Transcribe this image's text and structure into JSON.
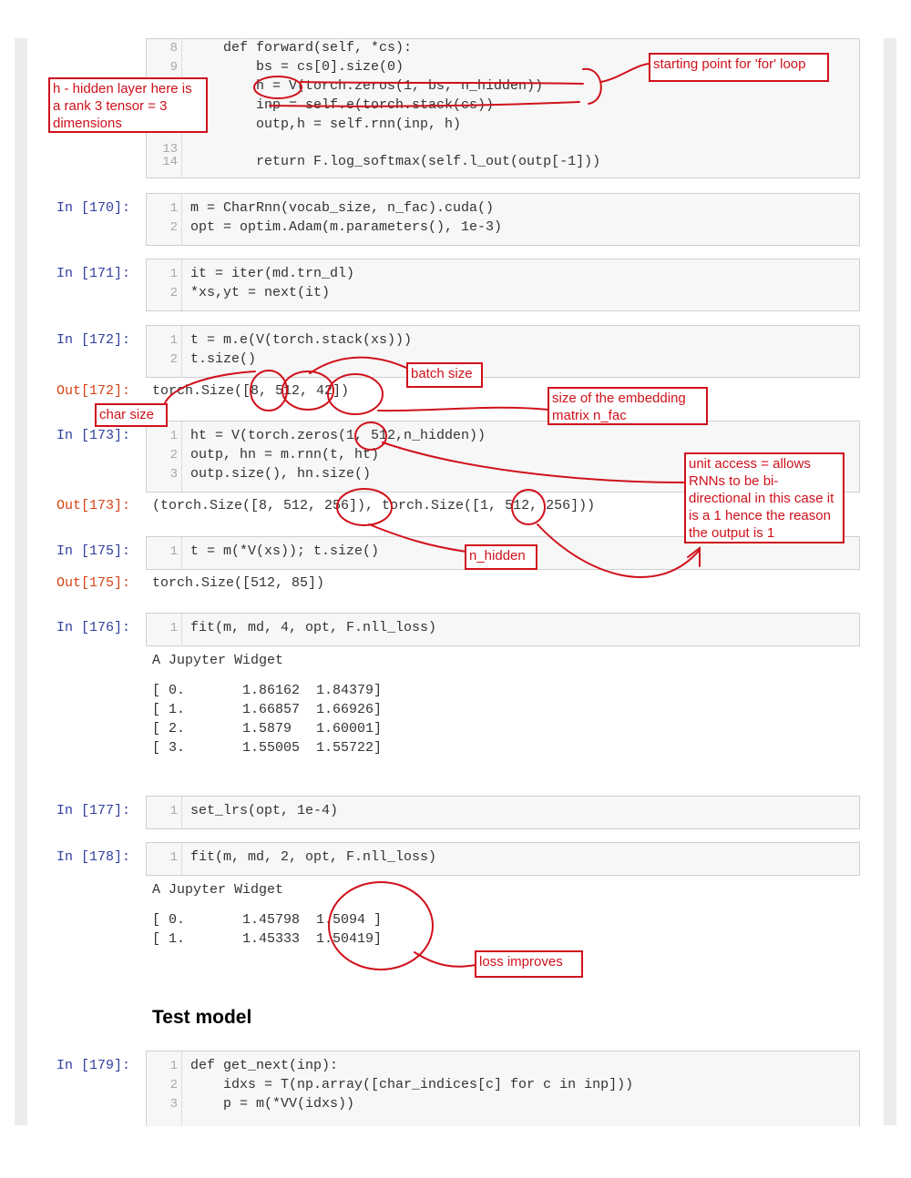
{
  "cells": [
    {
      "kind": "code-continued",
      "prompt": "",
      "lines": [
        {
          "n": "8",
          "text": "    def forward(self, *cs):"
        },
        {
          "n": "9",
          "text": "        bs = cs[0].size(0)"
        },
        {
          "n": "10",
          "text": "        h = V(torch.zeros(1, bs, n_hidden))"
        },
        {
          "n": "11",
          "text": "        inp = self.e(torch.stack(cs))"
        },
        {
          "n": "12",
          "text": "        outp,h = self.rnn(inp, h)"
        },
        {
          "n": "13",
          "text": ""
        },
        {
          "n": "14",
          "text": "        return F.log_softmax(self.l_out(outp[-1]))"
        }
      ]
    },
    {
      "prompt": "In [170]:",
      "lines": [
        {
          "n": "1",
          "text": "m = CharRnn(vocab_size, n_fac).cuda()"
        },
        {
          "n": "2",
          "text": "opt = optim.Adam(m.parameters(), 1e-3)"
        }
      ]
    },
    {
      "prompt": "In [171]:",
      "lines": [
        {
          "n": "1",
          "text": "it = iter(md.trn_dl)"
        },
        {
          "n": "2",
          "text": "*xs,yt = next(it)"
        }
      ]
    },
    {
      "prompt": "In [172]:",
      "lines": [
        {
          "n": "1",
          "text": "t = m.e(V(torch.stack(xs)))"
        },
        {
          "n": "2",
          "text": "t.size()"
        }
      ]
    },
    {
      "prompt": "In [173]:",
      "lines": [
        {
          "n": "1",
          "text": "ht = V(torch.zeros(1, 512,n_hidden))"
        },
        {
          "n": "2",
          "text": "outp, hn = m.rnn(t, ht)"
        },
        {
          "n": "3",
          "text": "outp.size(), hn.size()"
        }
      ]
    },
    {
      "prompt": "In [175]:",
      "lines": [
        {
          "n": "1",
          "text": "t = m(*V(xs)); t.size()"
        }
      ]
    },
    {
      "prompt": "In [176]:",
      "lines": [
        {
          "n": "1",
          "text": "fit(m, md, 4, opt, F.nll_loss)"
        }
      ]
    },
    {
      "prompt": "In [177]:",
      "lines": [
        {
          "n": "1",
          "text": "set_lrs(opt, 1e-4)"
        }
      ]
    },
    {
      "prompt": "In [178]:",
      "lines": [
        {
          "n": "1",
          "text": "fit(m, md, 2, opt, F.nll_loss)"
        }
      ]
    },
    {
      "prompt": "In [179]:",
      "lines": [
        {
          "n": "1",
          "text": "def get_next(inp):"
        },
        {
          "n": "2",
          "text": "    idxs = T(np.array([char_indices[c] for c in inp]))"
        },
        {
          "n": "3",
          "text": "    p = m(*VV(idxs))"
        }
      ]
    }
  ],
  "outputs": {
    "out172": {
      "prompt": "Out[172]:",
      "text": "torch.Size([8, 512, 42])"
    },
    "out173": {
      "prompt": "Out[173]:",
      "text": "(torch.Size([8, 512, 256]), torch.Size([1, 512, 256]))"
    },
    "out175": {
      "prompt": "Out[175]:",
      "text": "torch.Size([512, 85])"
    },
    "fit176": {
      "widget": "A Jupyter Widget",
      "rows": [
        "[ 0.       1.86162  1.84379]",
        "[ 1.       1.66857  1.66926]",
        "[ 2.       1.5879   1.60001]",
        "[ 3.       1.55005  1.55722]"
      ]
    },
    "fit178": {
      "widget": "A Jupyter Widget",
      "rows": [
        "[ 0.       1.45798  1.5094 ]",
        "[ 1.       1.45333  1.50419]"
      ]
    }
  },
  "heading": "Test model",
  "annotations": {
    "hidden_layer": "h - hidden layer here is a rank 3 tensor = 3 dimensions",
    "for_loop": "starting point for 'for' loop",
    "batch_size": "batch size",
    "embedding": "size of the embedding matrix n_fac",
    "char_size": "char size",
    "unit_access": "unit access = allows RNNs to be bi-directional in this case it is a 1 hence the reason the output is 1",
    "n_hidden": "n_hidden",
    "loss": "loss improves"
  },
  "colors": {
    "annotation": "#d0111b",
    "in_prompt": "#303f9f",
    "out_prompt": "#d84315",
    "keyword": "#008000"
  }
}
